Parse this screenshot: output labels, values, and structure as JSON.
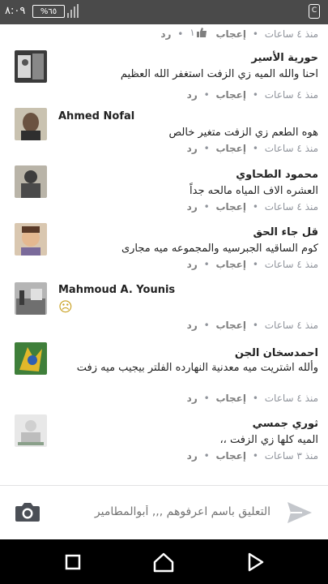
{
  "status_bar": {
    "time": "٨:٠٩",
    "battery": "%٦٥",
    "app_icon_label": "C"
  },
  "top_meta": {
    "time": "منذ ٤ ساعات",
    "like": "إعجاب",
    "likes_count": "١",
    "reply": "رد"
  },
  "comments": [
    {
      "name": "حورية الأسير",
      "text": "احنا والله الميه زي الزفت استغفر الله العظيم",
      "time": "منذ ٤ ساعات",
      "like": "إعجاب",
      "reply": "رد"
    },
    {
      "name": "Ahmed Nofal",
      "text": "هوه الطعم زي الزفت متغير خالص",
      "time": "منذ ٤ ساعات",
      "like": "إعجاب",
      "reply": "رد"
    },
    {
      "name": "محمود الطحاوي",
      "text": "العشره الاف المياه مالحه جداً",
      "time": "منذ ٤ ساعات",
      "like": "إعجاب",
      "reply": "رد"
    },
    {
      "name": "قل جاء الحق",
      "text": "كوم الساقيه الجبرسيه والمجموعه ميه مجارى",
      "time": "منذ ٤ ساعات",
      "like": "إعجاب",
      "reply": "رد"
    },
    {
      "name": "Mahmoud A. Younis",
      "text": "☹",
      "time": "منذ ٤ ساعات",
      "like": "إعجاب",
      "reply": "رد"
    },
    {
      "name": "احمدسخان الجن",
      "text": "وألله اشتريت ميه معدنية  النهارده الفلتر بيجيب ميه زفت",
      "time": "منذ ٤ ساعات",
      "like": "إعجاب",
      "reply": "رد"
    },
    {
      "name": "ثوري جمسي",
      "text": "الميه كلها زي الزفت ،،",
      "time": "منذ ٣ ساعات",
      "like": "إعجاب",
      "reply": "رد"
    }
  ],
  "composer": {
    "placeholder": "التعليق باسم اعرفوهم ,,, أبوالمطامير"
  },
  "icons": {
    "camera": "camera-icon",
    "send": "send-icon",
    "recent": "recent-apps-icon",
    "home": "home-icon",
    "back": "back-icon"
  },
  "colors": {
    "meta_gray": "#90949c",
    "action_gray": "#7f7f7f",
    "status_bar": "#4a4a4a",
    "nav_bar": "#000000"
  }
}
